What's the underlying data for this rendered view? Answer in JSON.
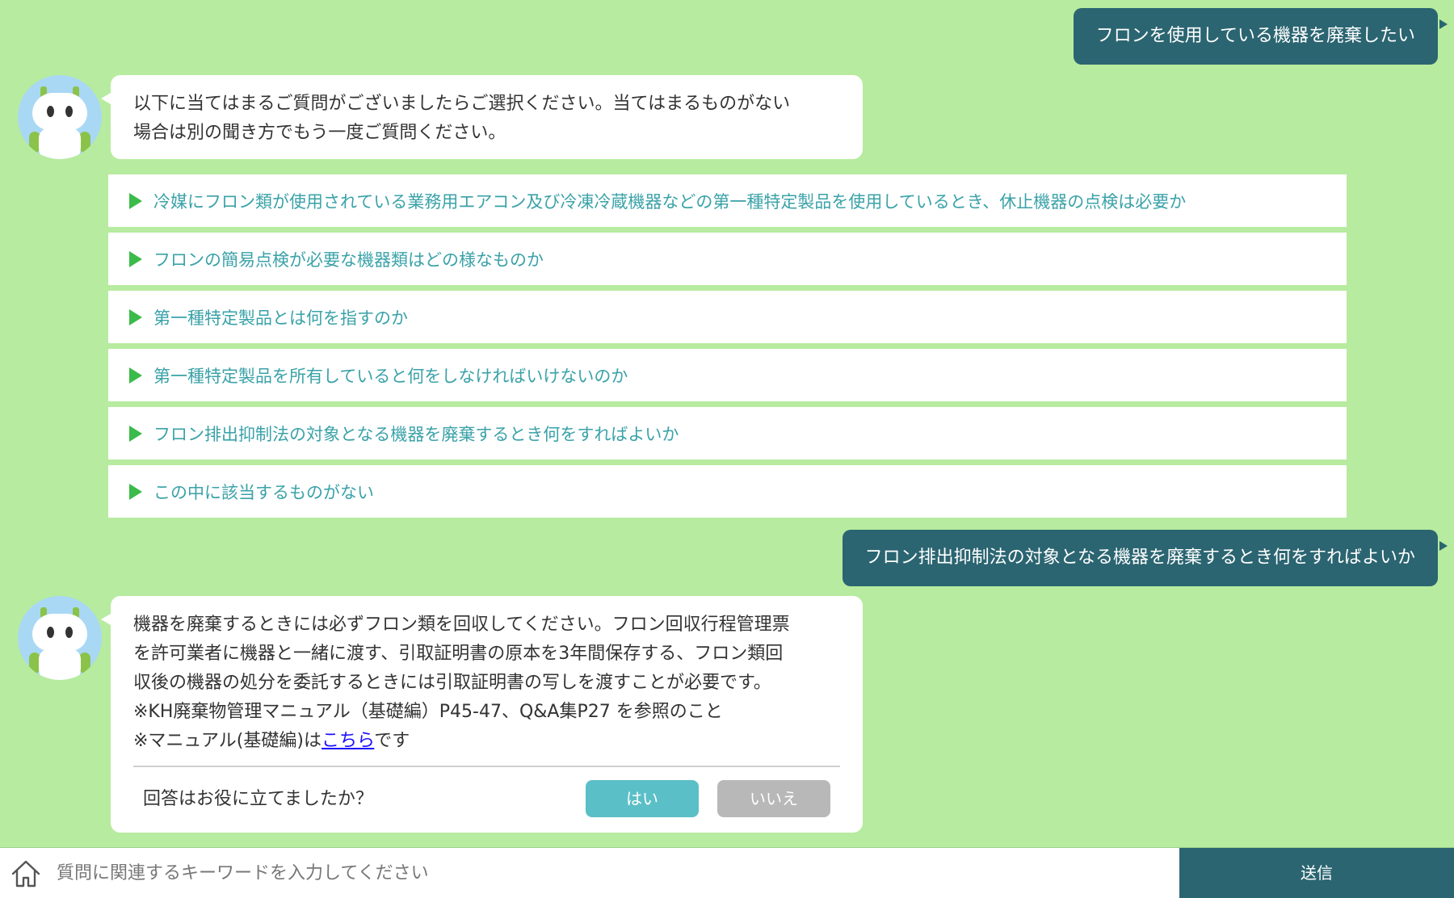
{
  "messages": {
    "user1": "フロンを使用している機器を廃棄したい",
    "bot1_lines": [
      "以下に当てはまるご質問がございましたらご選択ください。当てはまるものがない",
      "場合は別の聞き方でもう一度ご質問ください。"
    ],
    "options": [
      "冷媒にフロン類が使用されている業務用エアコン及び冷凍冷蔵機器などの第一種特定製品を使用しているとき、休止機器の点検は必要か",
      "フロンの簡易点検が必要な機器類はどの様なものか",
      "第一種特定製品とは何を指すのか",
      "第一種特定製品を所有していると何をしなければいけないのか",
      "フロン排出抑制法の対象となる機器を廃棄するとき何をすればよいか",
      "この中に該当するものがない"
    ],
    "user2": "フロン排出抑制法の対象となる機器を廃棄するとき何をすればよいか",
    "bot2_lines": [
      "機器を廃棄するときには必ずフロン類を回収してください。フロン回収行程管理票",
      "を許可業者に機器と一緒に渡す、引取証明書の原本を3年間保存する、フロン類回",
      "収後の機器の処分を委託するときには引取証明書の写しを渡すことが必要です。",
      "※KH廃棄物管理マニュアル（基礎編）P45-47、Q&A集P27 を参照のこと"
    ],
    "bot2_last_prefix": "※マニュアル(基礎編)は",
    "bot2_link": "こちら",
    "bot2_last_suffix": "です",
    "feedback": {
      "question": "回答はお役に立てましたか？",
      "yes": "はい",
      "no": "いいえ"
    }
  },
  "input_bar": {
    "placeholder": "質問に関連するキーワードを入力してください",
    "send_label": "送信"
  },
  "colors": {
    "background": "#b7eb9f",
    "user_bubble": "#2b6571",
    "option_text": "#3aa2a8",
    "option_arrow": "#3bbb4a",
    "yes_button": "#5bbfc7",
    "no_button": "#b8b8b8",
    "send_button": "#2b6571"
  }
}
